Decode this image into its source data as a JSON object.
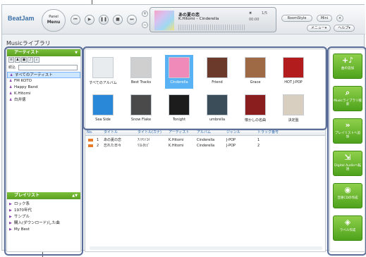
{
  "app": {
    "logo": "BeatJam",
    "panel_button": {
      "line1": "Panel",
      "line2": "Menu"
    },
    "now_playing": {
      "song": "あの夏の恋",
      "meta": "K.Hitomi – Cinderella",
      "time": "00:00",
      "counter": "1/5"
    },
    "buttons": {
      "roomstyle": "RoomStyle",
      "mini": "Mini",
      "menu": "メニュー▾",
      "help": "ヘルプ▾"
    },
    "library_title": "Musicライブラリ"
  },
  "left_panel": {
    "artist_header": "アーティスト",
    "filter_label": "絞込",
    "artists": [
      "すべてのアーティスト",
      "FM KOTO",
      "Happy Band",
      "K.Hitomi",
      "白井徳"
    ],
    "playlist_header": "プレイリスト",
    "playlists": [
      "ロック系",
      "1970年代",
      "サンプル",
      "購入(ダウンロード)した曲",
      "My Best"
    ]
  },
  "albums": [
    {
      "name": "すべてのアルバム",
      "color": "#e9ecef"
    },
    {
      "name": "Best Tracks",
      "color": "#cfcfcf"
    },
    {
      "name": "Cinderella",
      "color": "#f08ab8"
    },
    {
      "name": "Friend",
      "color": "#6b3a2a"
    },
    {
      "name": "Grace",
      "color": "#9e6a45"
    },
    {
      "name": "HOT J-POP",
      "color": "#b21c1c"
    },
    {
      "name": "Sea Side",
      "color": "#2a88d8"
    },
    {
      "name": "Snow Flake",
      "color": "#4a4a4a"
    },
    {
      "name": "Tonight",
      "color": "#1c1c1c"
    },
    {
      "name": "umbrella",
      "color": "#3c4d5a"
    },
    {
      "name": "懐かしの名曲",
      "color": "#8a1d1d"
    },
    {
      "name": "決定盤",
      "color": "#d8cfc0"
    }
  ],
  "tracks": {
    "columns": [
      "No.",
      "タイトル",
      "タイトル(カナ)",
      "アーティスト",
      "アルバム",
      "ジャンル",
      "トラック番号"
    ],
    "rows": [
      [
        "1",
        "あの夏の恋",
        "ｱﾉﾅﾂﾉｺｲ",
        "K.Hitomi",
        "Cinderella",
        "J-POP",
        "1"
      ],
      [
        "2",
        "忘れた日々",
        "ﾜｽﾚﾀﾋﾋﾞ",
        "K.Hitomi",
        "Cinderella",
        "J-POP",
        "2"
      ]
    ]
  },
  "right_panel": [
    {
      "icon": "+♪",
      "label": "曲の追加"
    },
    {
      "icon": "⌕",
      "label": "Musicライブラリ検索"
    },
    {
      "icon": "»",
      "label": "プレイリストへ追加"
    },
    {
      "icon": "⇲",
      "label": "Digital Audioへ転送"
    },
    {
      "icon": "◉",
      "label": "音楽CDの作成"
    },
    {
      "icon": "◈",
      "label": "ラベル作成"
    }
  ]
}
